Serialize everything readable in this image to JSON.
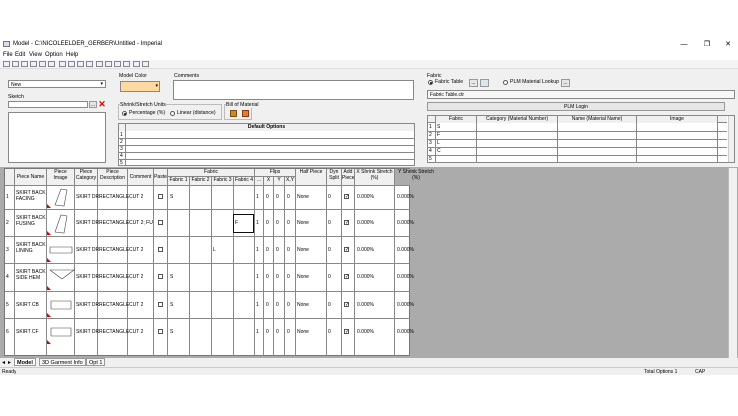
{
  "window": {
    "title": "Model - C:\\NICOLEELDER_GERBER\\Untitled - Imperial",
    "minimize": "—",
    "maximize": "❐",
    "close": "✕"
  },
  "menu": [
    "File",
    "Edit",
    "View",
    "Option",
    "Help"
  ],
  "model": {
    "name_value": "New",
    "sketch_label": "Sketch",
    "sketch_browse": "..."
  },
  "model_color": {
    "label": "Model Color",
    "swatch": "#fcd9a0"
  },
  "comments": {
    "label": "Comments"
  },
  "shrink": {
    "label": "Shrink/Stretch Units",
    "percentage": "Percentage (%)",
    "linear": "Linear (distance)"
  },
  "bom": {
    "label": "Bill of Material"
  },
  "options": {
    "header": "Default Options",
    "rows": [
      "1",
      "2",
      "3",
      "4",
      "5"
    ]
  },
  "fabric": {
    "label": "Fabric",
    "table_radio": "Fabric Table",
    "table_browse": "...",
    "plm_radio": "PLM Material Lookup",
    "plm_browse": "...",
    "file_value": "Fabric Table.ctr",
    "plm_login": "PLM Login",
    "columns": [
      "Fabric",
      "Category (Material Number)",
      "Name (Material Name)",
      "Image"
    ],
    "rows": [
      {
        "num": "1",
        "code": "S"
      },
      {
        "num": "2",
        "code": "F"
      },
      {
        "num": "3",
        "code": "L"
      },
      {
        "num": "4",
        "code": "C"
      },
      {
        "num": "5",
        "code": ""
      }
    ]
  },
  "pieces": {
    "headers": {
      "name": "Piece Name",
      "image": "Piece Image",
      "category": "Piece Category",
      "desc": "Piece Description",
      "comment": "Comment",
      "paste": "Paste",
      "fabric": "Fabric",
      "fabric1": "Fabric 1",
      "fabric2": "Fabric 2",
      "fabric3": "Fabric 3",
      "fabric4": "Fabric 4",
      "dots": "...",
      "flips": "Flips",
      "x": "X",
      "y": "Y",
      "xy": "X,Y",
      "half": "Half Piece",
      "dyn": "Dyn Split",
      "add": "Add Piece",
      "xshrink": "X Shrink Stretch (%)",
      "yshrink": "Y Shrink Stretch (%)"
    },
    "rows": [
      {
        "num": "1",
        "name1": "SKIRT BACK",
        "name2": "FACING",
        "category": "SKIRT DR",
        "desc": "RECTANGLE",
        "comment": "CUT 2",
        "f1": "S",
        "f2": "",
        "f3": "",
        "f4": "",
        "n": "1",
        "x": "0",
        "y": "0",
        "xy": "0",
        "half": "None",
        "dyn": "0",
        "xs": "0.000%",
        "ys": "0.000%"
      },
      {
        "num": "2",
        "name1": "SKIRT BACK",
        "name2": "FUSING",
        "category": "SKIRT DR",
        "desc": "RECTANGLE",
        "comment": "CUT 2; FU",
        "f1": "",
        "f2": "",
        "f3": "",
        "f4": "F",
        "n": "1",
        "x": "0",
        "y": "0",
        "xy": "0",
        "half": "None",
        "dyn": "0",
        "xs": "0.000%",
        "ys": "0.000%"
      },
      {
        "num": "3",
        "name1": "SKIRT BACK",
        "name2": "LINING",
        "category": "SKIRT DR",
        "desc": "RECTANGLE",
        "comment": "CUT 2",
        "f1": "",
        "f2": "",
        "f3": "L",
        "f4": "",
        "n": "1",
        "x": "0",
        "y": "0",
        "xy": "0",
        "half": "None",
        "dyn": "0",
        "xs": "0.000%",
        "ys": "0.000%"
      },
      {
        "num": "4",
        "name1": "SKIRT BACK",
        "name2": "SIDE HEM",
        "category": "SKIRT DR",
        "desc": "RECTANGLE",
        "comment": "CUT 2",
        "f1": "S",
        "f2": "",
        "f3": "",
        "f4": "",
        "n": "1",
        "x": "0",
        "y": "0",
        "xy": "0",
        "half": "None",
        "dyn": "0",
        "xs": "0.000%",
        "ys": "0.000%"
      },
      {
        "num": "5",
        "name1": "SKIRT CB",
        "name2": "",
        "category": "SKIRT DR",
        "desc": "RECTANGLE",
        "comment": "CUT 2",
        "f1": "S",
        "f2": "",
        "f3": "",
        "f4": "",
        "n": "1",
        "x": "0",
        "y": "0",
        "xy": "0",
        "half": "None",
        "dyn": "0",
        "xs": "0.000%",
        "ys": "0.000%"
      },
      {
        "num": "6",
        "name1": "SKIRT CF",
        "name2": "",
        "category": "SKIRT DR",
        "desc": "RECTANGLE",
        "comment": "CUT 2",
        "f1": "S",
        "f2": "",
        "f3": "",
        "f4": "",
        "n": "1",
        "x": "0",
        "y": "0",
        "xy": "0",
        "half": "None",
        "dyn": "0",
        "xs": "0.000%",
        "ys": "0.000%"
      }
    ]
  },
  "tabs": [
    "Model",
    "3D Garment Info",
    "Opt 1"
  ],
  "status": {
    "left": "Ready",
    "total": "Total Options 1",
    "caps": "CAP"
  }
}
